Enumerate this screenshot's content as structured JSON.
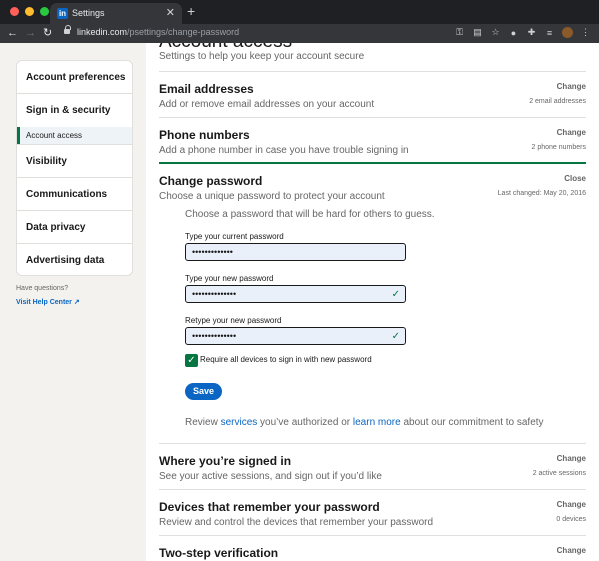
{
  "browser": {
    "tab_title": "Settings",
    "tab_favicon": "in",
    "url_host": "linkedin.com",
    "url_path": "/psettings/change-password",
    "newtab_symbol": "+",
    "close_symbol": "✕"
  },
  "sidebar": {
    "items": [
      {
        "label": "Account preferences"
      },
      {
        "label": "Sign in & security",
        "sub": "Account access"
      },
      {
        "label": "Visibility"
      },
      {
        "label": "Communications"
      },
      {
        "label": "Data privacy"
      },
      {
        "label": "Advertising data"
      }
    ],
    "help_question": "Have questions?",
    "help_link": "Visit Help Center"
  },
  "main": {
    "title": "Account access",
    "subtitle": "Settings to help you keep your account secure",
    "sections": [
      {
        "title": "Email addresses",
        "desc": "Add or remove email addresses on your account",
        "action": "Change",
        "meta": "2 email addresses"
      },
      {
        "title": "Phone numbers",
        "desc": "Add a phone number in case you have trouble signing in",
        "action": "Change",
        "meta": "2 phone numbers"
      },
      {
        "title": "Change password",
        "desc": "Choose a unique password to protect your account",
        "action": "Close",
        "meta": "Last changed: May 20, 2016"
      },
      {
        "title": "Where you’re signed in",
        "desc": "See your active sessions, and sign out if you’d like",
        "action": "Change",
        "meta": "2 active sessions"
      },
      {
        "title": "Devices that remember your password",
        "desc": "Review and control the devices that remember your password",
        "action": "Change",
        "meta": "0 devices"
      },
      {
        "title": "Two-step verification",
        "action": "Change"
      }
    ],
    "password_form": {
      "intro": "Choose a password that will be hard for others to guess.",
      "current_label": "Type your current password",
      "current_value": "•••••••••••••",
      "new_label": "Type your new password",
      "new_value": "••••••••••••••",
      "retype_label": "Retype your new password",
      "retype_value": "••••••••••••••",
      "checkbox_label": "Require all devices to sign in with new password",
      "checkbox_checked": true,
      "save_label": "Save",
      "review_prefix": "Review ",
      "review_link1": "services",
      "review_mid": " you’ve authorized or ",
      "review_link2": "learn more",
      "review_suffix": " about our commitment to safety"
    }
  },
  "colors": {
    "accent_green": "#057642",
    "link_blue": "#0a66c2"
  }
}
